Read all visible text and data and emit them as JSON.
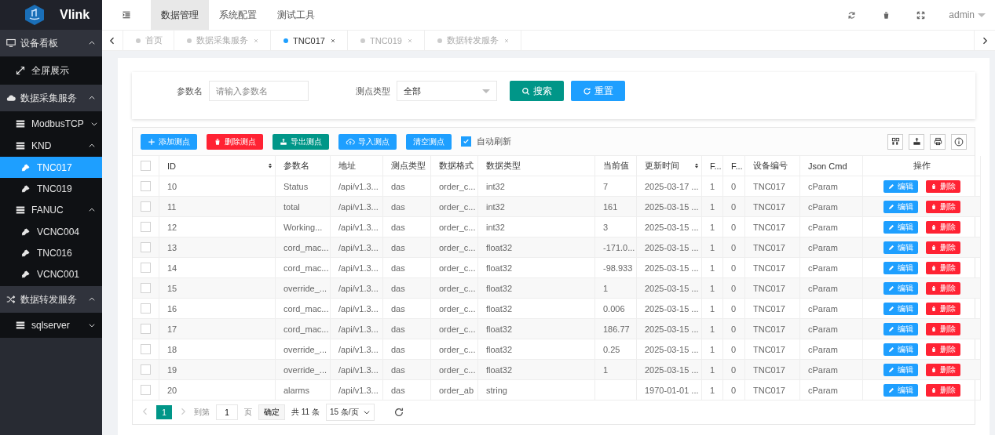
{
  "app": {
    "name": "Vlink"
  },
  "sidebar": {
    "items": [
      {
        "label": "设备看板",
        "expanded": true,
        "children": [
          {
            "label": "全屏展示",
            "selected": false
          }
        ]
      },
      {
        "label": "数据采集服务",
        "expanded": true,
        "children": [
          {
            "label": "ModbusTCP",
            "expanded": false
          },
          {
            "label": "KND",
            "expanded": true,
            "children": [
              {
                "label": "TNC017",
                "selected": true
              },
              {
                "label": "TNC019",
                "selected": false
              }
            ]
          },
          {
            "label": "FANUC",
            "expanded": true,
            "children": [
              {
                "label": "VCNC004",
                "selected": false
              },
              {
                "label": "TNC016",
                "selected": false
              },
              {
                "label": "VCNC001",
                "selected": false
              }
            ]
          }
        ]
      },
      {
        "label": "数据转发服务",
        "expanded": true,
        "children": [
          {
            "label": "sqlserver",
            "expanded": false
          }
        ]
      }
    ]
  },
  "top_nav": [
    {
      "label": "数据管理",
      "selected": true
    },
    {
      "label": "系统配置",
      "selected": false
    },
    {
      "label": "测试工具",
      "selected": false
    }
  ],
  "user": "admin",
  "tabs": [
    {
      "label": "首页",
      "selected": false,
      "closable": false
    },
    {
      "label": "数据采集服务",
      "selected": false,
      "closable": true
    },
    {
      "label": "TNC017",
      "selected": true,
      "closable": true
    },
    {
      "label": "TNC019",
      "selected": false,
      "closable": true
    },
    {
      "label": "数据转发服务",
      "selected": false,
      "closable": true
    }
  ],
  "search": {
    "name_label": "参数名",
    "name_placeholder": "请输入参数名",
    "type_label": "测点类型",
    "type_value": "全部",
    "search_button": "搜索",
    "reset_button": "重置"
  },
  "toolbar": {
    "buttons": [
      {
        "label": "添加测点",
        "kind": "primary"
      },
      {
        "label": "删除测点",
        "kind": "danger"
      },
      {
        "label": "导出测点",
        "kind": "success"
      },
      {
        "label": "导入测点",
        "kind": "primary"
      },
      {
        "label": "清空测点",
        "kind": "primary"
      }
    ],
    "auto_refresh": {
      "label": "自动刷新",
      "checked": true
    }
  },
  "table": {
    "all_checked": false,
    "columns": [
      {
        "label": "ID",
        "sortable": true
      },
      {
        "label": "参数名",
        "sortable": false
      },
      {
        "label": "地址",
        "sortable": false
      },
      {
        "label": "测点类型",
        "sortable": false
      },
      {
        "label": "数据格式",
        "sortable": false
      },
      {
        "label": "数据类型",
        "sortable": false
      },
      {
        "label": "当前值",
        "sortable": false
      },
      {
        "label": "更新时间",
        "sortable": true
      },
      {
        "label": "F...",
        "sortable": false
      },
      {
        "label": "F...",
        "sortable": false
      },
      {
        "label": "设备编号",
        "sortable": false
      },
      {
        "label": "Json Cmd",
        "sortable": false
      },
      {
        "label": "操作",
        "sortable": false
      }
    ],
    "rows": [
      {
        "checked": false,
        "cells": [
          "10",
          "Status",
          "/api/v1.3...",
          "das",
          "order_c...",
          "int32",
          "7",
          "2025-03-17 ...",
          "1",
          "0",
          "TNC017",
          "cParam"
        ],
        "actions": [
          "编辑",
          "删除"
        ]
      },
      {
        "checked": false,
        "cells": [
          "11",
          "total",
          "/api/v1.3...",
          "das",
          "order_c...",
          "int32",
          "161",
          "2025-03-15 ...",
          "1",
          "0",
          "TNC017",
          "cParam"
        ],
        "actions": [
          "编辑",
          "删除"
        ]
      },
      {
        "checked": false,
        "cells": [
          "12",
          "Working...",
          "/api/v1.3...",
          "das",
          "order_c...",
          "int32",
          "3",
          "2025-03-15 ...",
          "1",
          "0",
          "TNC017",
          "cParam"
        ],
        "actions": [
          "编辑",
          "删除"
        ]
      },
      {
        "checked": false,
        "cells": [
          "13",
          "cord_mac...",
          "/api/v1.3...",
          "das",
          "order_c...",
          "float32",
          "-171.0...",
          "2025-03-15 ...",
          "1",
          "0",
          "TNC017",
          "cParam"
        ],
        "actions": [
          "编辑",
          "删除"
        ]
      },
      {
        "checked": false,
        "cells": [
          "14",
          "cord_mac...",
          "/api/v1.3...",
          "das",
          "order_c...",
          "float32",
          "-98.933",
          "2025-03-15 ...",
          "1",
          "0",
          "TNC017",
          "cParam"
        ],
        "actions": [
          "编辑",
          "删除"
        ]
      },
      {
        "checked": false,
        "cells": [
          "15",
          "override_...",
          "/api/v1.3...",
          "das",
          "order_c...",
          "float32",
          "1",
          "2025-03-15 ...",
          "1",
          "0",
          "TNC017",
          "cParam"
        ],
        "actions": [
          "编辑",
          "删除"
        ]
      },
      {
        "checked": false,
        "cells": [
          "16",
          "cord_mac...",
          "/api/v1.3...",
          "das",
          "order_c...",
          "float32",
          "0.006",
          "2025-03-15 ...",
          "1",
          "0",
          "TNC017",
          "cParam"
        ],
        "actions": [
          "编辑",
          "删除"
        ]
      },
      {
        "checked": false,
        "cells": [
          "17",
          "cord_mac...",
          "/api/v1.3...",
          "das",
          "order_c...",
          "float32",
          "186.77",
          "2025-03-15 ...",
          "1",
          "0",
          "TNC017",
          "cParam"
        ],
        "actions": [
          "编辑",
          "删除"
        ]
      },
      {
        "checked": false,
        "cells": [
          "18",
          "override_...",
          "/api/v1.3...",
          "das",
          "order_c...",
          "float32",
          "0.25",
          "2025-03-15 ...",
          "1",
          "0",
          "TNC017",
          "cParam"
        ],
        "actions": [
          "编辑",
          "删除"
        ]
      },
      {
        "checked": false,
        "cells": [
          "19",
          "override_...",
          "/api/v1.3...",
          "das",
          "order_c...",
          "float32",
          "1",
          "2025-03-15 ...",
          "1",
          "0",
          "TNC017",
          "cParam"
        ],
        "actions": [
          "编辑",
          "删除"
        ]
      },
      {
        "checked": false,
        "cells": [
          "20",
          "alarms",
          "/api/v1.3...",
          "das",
          "order_ab",
          "string",
          "",
          "1970-01-01 ...",
          "1",
          "0",
          "TNC017",
          "cParam"
        ],
        "actions": [
          "编辑",
          "删除"
        ]
      }
    ]
  },
  "pagination": {
    "pages": [
      {
        "label": "1",
        "selected": true
      }
    ],
    "goto_label": "到第",
    "page_input": "1",
    "page_suffix": "页",
    "confirm": "确定",
    "total": "共 11 条",
    "page_size": "15 条/页"
  }
}
